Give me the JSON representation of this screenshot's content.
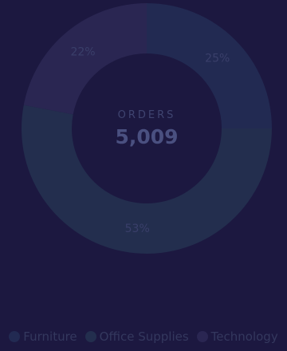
{
  "chart_data": {
    "type": "pie",
    "donut": true,
    "center": {
      "label": "ORDERS",
      "value": "5,009"
    },
    "categories": [
      "Furniture",
      "Office Supplies",
      "Technology"
    ],
    "values": [
      25,
      53,
      22
    ],
    "value_labels": [
      "25%",
      "53%",
      "22%"
    ],
    "colors": [
      "#222a52",
      "#232e4e",
      "#2a2652"
    ],
    "legend": "bottom"
  }
}
